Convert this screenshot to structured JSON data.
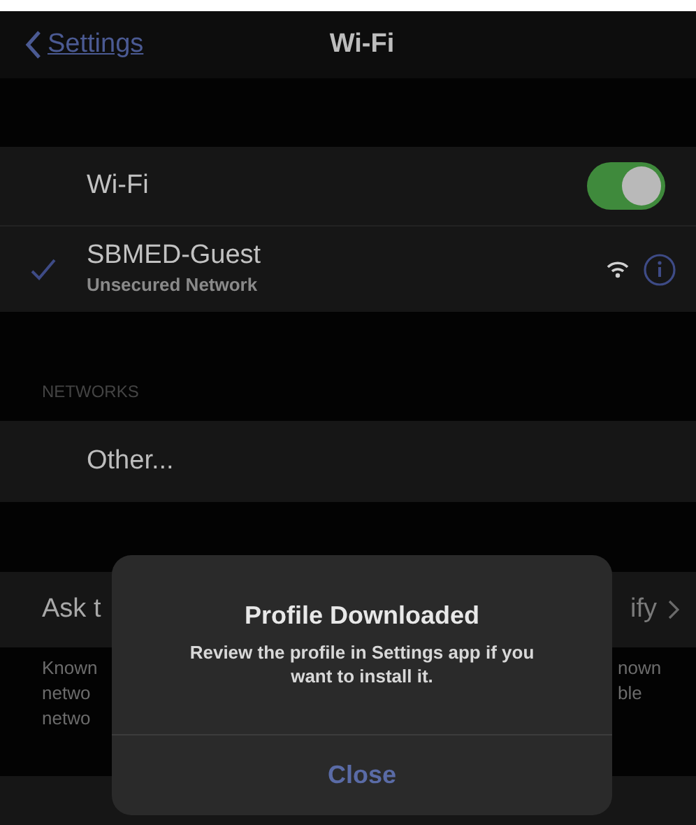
{
  "nav": {
    "back": "Settings",
    "title": "Wi-Fi"
  },
  "wifi_row": {
    "label": "Wi-Fi",
    "on": true
  },
  "connected": {
    "name": "SBMED-Guest",
    "subtitle": "Unsecured Network",
    "checked": true
  },
  "networks_header": "NETWORKS",
  "other_row": {
    "label": "Other..."
  },
  "ask_row": {
    "left": "Ask t",
    "right": "ify"
  },
  "footer": {
    "left_lines": [
      "Known",
      "netwo",
      "netwo"
    ],
    "right_lines": [
      "nown",
      "ble"
    ]
  },
  "alert": {
    "title": "Profile Downloaded",
    "message": "Review the profile in Settings app if you want to install it.",
    "button": "Close"
  }
}
